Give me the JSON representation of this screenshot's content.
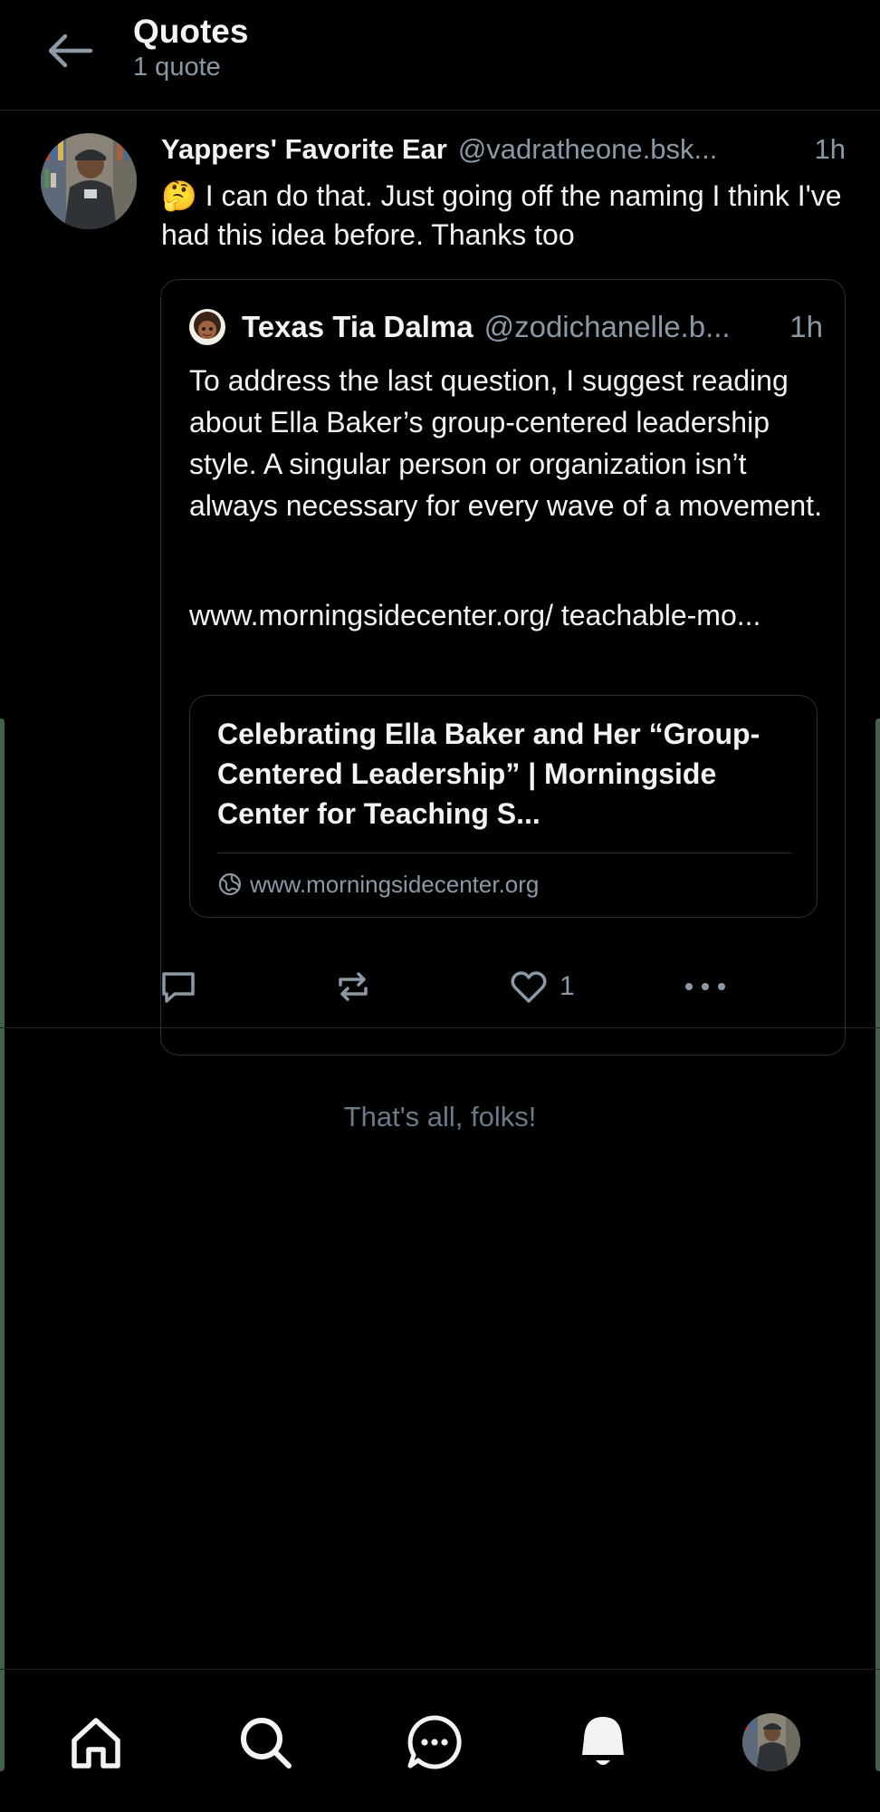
{
  "header": {
    "title": "Quotes",
    "subtitle": "1 quote"
  },
  "post": {
    "author_name": "Yappers' Favorite Ear",
    "author_handle": "@vadratheone.bsk...",
    "time": "1h",
    "text": "🤔 I can do that. Just going off the naming I think I've had this idea before. Thanks too",
    "quoted": {
      "author_name": "Texas Tia Dalma",
      "author_handle": "@zodichanelle.b...",
      "time": "1h",
      "text": "To address the last question, I suggest reading about Ella Baker’s group-centered leadership style. A singular person or organization isn’t always necessary for every wave of a movement.",
      "link_text": "www.morningsidecenter.org/ teachable-mo...",
      "link_card": {
        "title": "Celebrating Ella Baker and Her “Group-Centered Leadership” | Morningside Center for Teaching S...",
        "domain": "www.morningsidecenter.org",
        "icon": "globe-icon"
      }
    },
    "actions": {
      "reply_icon": "reply-icon",
      "repost_icon": "repost-icon",
      "like_icon": "heart-icon",
      "like_count": "1",
      "more_icon": "more-icon"
    }
  },
  "end_message": "That's all, folks!",
  "bottom_nav": [
    {
      "name": "home",
      "icon": "home-icon"
    },
    {
      "name": "search",
      "icon": "search-icon"
    },
    {
      "name": "chat",
      "icon": "chat-icon"
    },
    {
      "name": "notifications",
      "icon": "bell-icon"
    },
    {
      "name": "profile",
      "icon": "avatar"
    }
  ],
  "colors": {
    "background": "#000000",
    "text": "#f1f3f5",
    "muted": "#8b98a5",
    "border": "#2a2f35",
    "edge_accent": "#45614a"
  }
}
